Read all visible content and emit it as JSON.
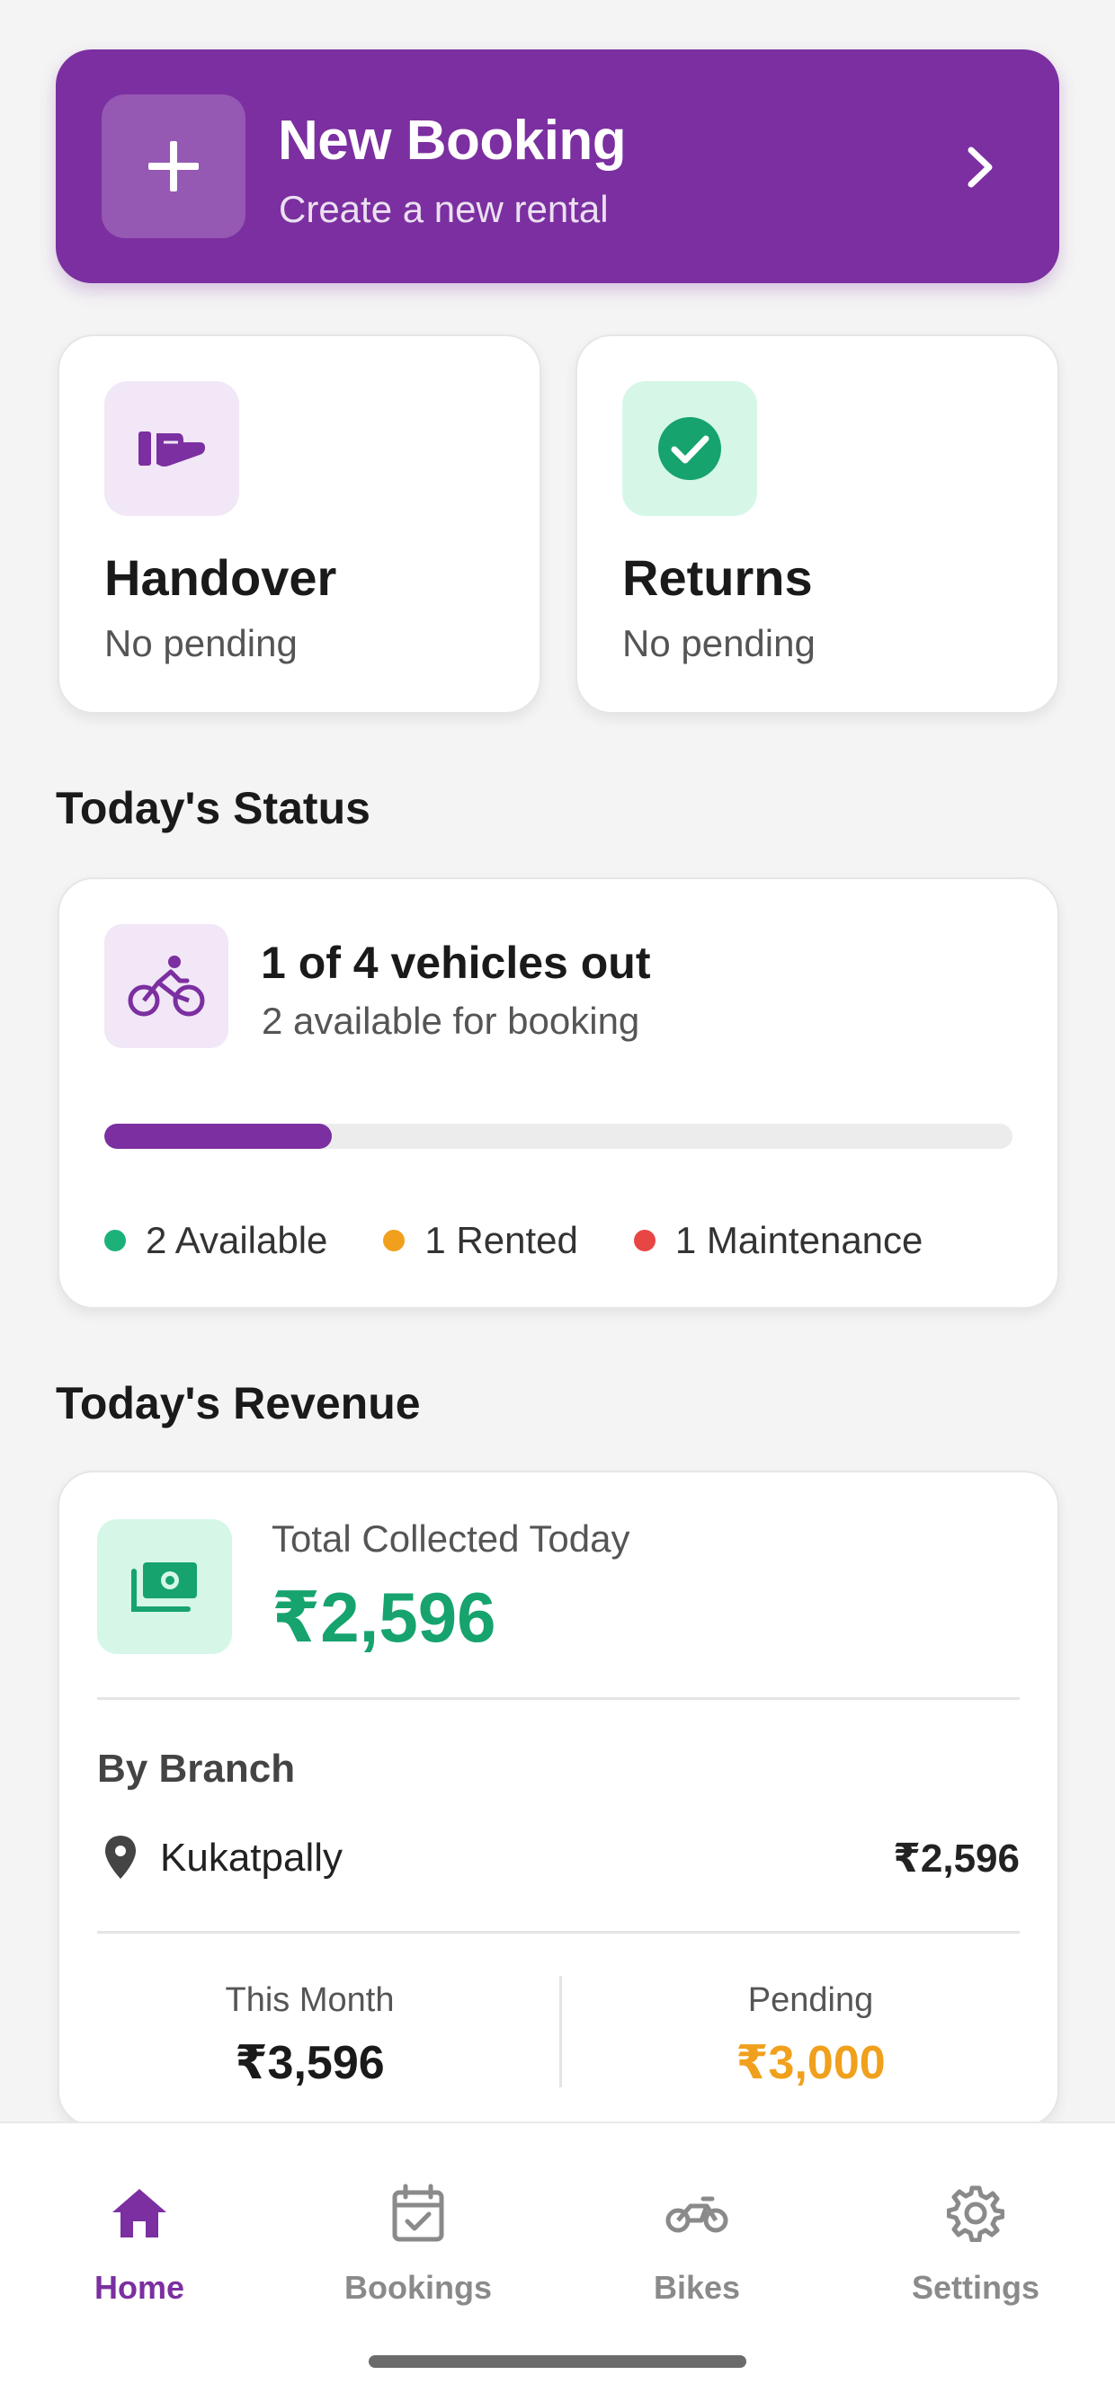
{
  "colors": {
    "brand": "#7b2fa0",
    "success": "#16a36e",
    "available": "#1db17a",
    "rented": "#f0a01c",
    "maintenance": "#e84545",
    "pending": "#f0a01c"
  },
  "new_booking": {
    "title": "New Booking",
    "subtitle": "Create a new rental",
    "icon": "plus-icon",
    "chevron": "chevron-right-icon"
  },
  "actions": {
    "handover": {
      "title": "Handover",
      "subtitle": "No pending",
      "icon": "hand-icon"
    },
    "returns": {
      "title": "Returns",
      "subtitle": "No pending",
      "icon": "check-circle-icon"
    }
  },
  "status": {
    "section_title": "Today's Status",
    "headline": "1 of 4 vehicles out",
    "subline": "2 available for booking",
    "icon": "bicycle-icon",
    "progress_fraction": 0.25,
    "legend": {
      "available": "2 Available",
      "rented": "1 Rented",
      "maintenance": "1 Maintenance"
    }
  },
  "revenue": {
    "section_title": "Today's Revenue",
    "total_label": "Total Collected Today",
    "total_value": "₹2,596",
    "icon": "money-icon",
    "by_branch_label": "By Branch",
    "branches": [
      {
        "name": "Kukatpally",
        "amount": "₹2,596"
      }
    ],
    "this_month_label": "This Month",
    "this_month_value": "₹3,596",
    "pending_label": "Pending",
    "pending_value": "₹3,000"
  },
  "nav": {
    "home": "Home",
    "bookings": "Bookings",
    "bikes": "Bikes",
    "settings": "Settings",
    "active": "home"
  }
}
